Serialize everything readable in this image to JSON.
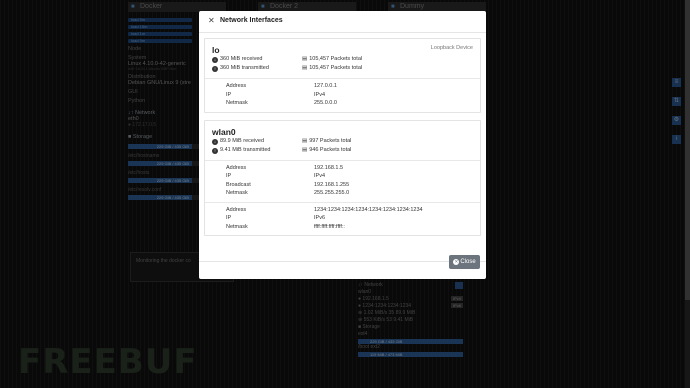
{
  "background": {
    "tabs": [
      "Docker",
      "Docker 2",
      "Dummy"
    ],
    "left_panel": {
      "pills": [
        "load 5m",
        "load 15m",
        "load 1m",
        "load 5m"
      ],
      "node_label": "Node",
      "system_label": "System",
      "system_value": "Linux 4.10.0-42-generic",
      "system_detail": "#46~16.04.1-Ubuntu SMP Mon",
      "distribution_label": "Distribution",
      "distribution_value": "Debian GNU/Linux 9 (stre",
      "gui_label": "GUI",
      "python_label": "Python",
      "network_label": "Network",
      "eth0": "eth0",
      "eth0_addr": "172.17.0.5",
      "storage_label": "Storage",
      "storage": [
        {
          "path": "",
          "usage": "229 GiB / 435 GiB"
        },
        {
          "path": "/etc/hostname",
          "usage": "229 GiB / 435 GiB"
        },
        {
          "path": "/etc/hosts",
          "usage": "229 GiB / 435 GiB"
        },
        {
          "path": "/etc/resolv.conf",
          "usage": "229 GiB / 435 GiB"
        }
      ],
      "monitor_text": "Monitoring the docker co"
    },
    "right_panel": {
      "network_label": "Network",
      "wlan0": "wlan0",
      "addr1": "192.168.1.5",
      "addr2": "1234:1234:1234:1234",
      "badge1": "IPv4",
      "badge2": "IPv6",
      "rx": "1.02 MiB/s",
      "tx": "553 KiB/s",
      "rx_packets": "35",
      "tx_packets": "53",
      "rx_total": "89.9 MiB",
      "tx_total": "9.41 MiB",
      "storage_label": "Storage",
      "root_usage": "229 GiB / 435 GiB",
      "root_fs": "ext4",
      "boot_label": "/boot",
      "boot_fs": "ext2",
      "boot_usage": "119 MiB / 473 MiB"
    },
    "watermark": "FREEBUF"
  },
  "modal": {
    "title": "Network Interfaces",
    "close_label": "Close",
    "interfaces": [
      {
        "name": "lo",
        "label": "Loopback Device",
        "received": "360 MiB received",
        "received_packets": "105,457 Packets total",
        "transmitted": "360 MiB transmitted",
        "transmitted_packets": "105,457 Packets total",
        "address_groups": [
          [
            {
              "k": "Address",
              "v": "127.0.0.1"
            },
            {
              "k": "IP",
              "v": "IPv4"
            },
            {
              "k": "Netmask",
              "v": "255.0.0.0"
            }
          ]
        ]
      },
      {
        "name": "wlan0",
        "label": "",
        "received": "89.9 MiB received",
        "received_packets": "997 Packets total",
        "transmitted": "9.41 MiB transmitted",
        "transmitted_packets": "946 Packets total",
        "address_groups": [
          [
            {
              "k": "Address",
              "v": "192.168.1.5"
            },
            {
              "k": "IP",
              "v": "IPv4"
            },
            {
              "k": "Broadcast",
              "v": "192.168.1.255"
            },
            {
              "k": "Netmask",
              "v": "255.255.255.0"
            }
          ],
          [
            {
              "k": "Address",
              "v": "1234:1234:1234:1234:1234:1234:1234:1234"
            },
            {
              "k": "IP",
              "v": "IPv6"
            },
            {
              "k": "Netmask",
              "v": "ffff:ffff:ffff:ffff::"
            }
          ]
        ]
      }
    ]
  }
}
